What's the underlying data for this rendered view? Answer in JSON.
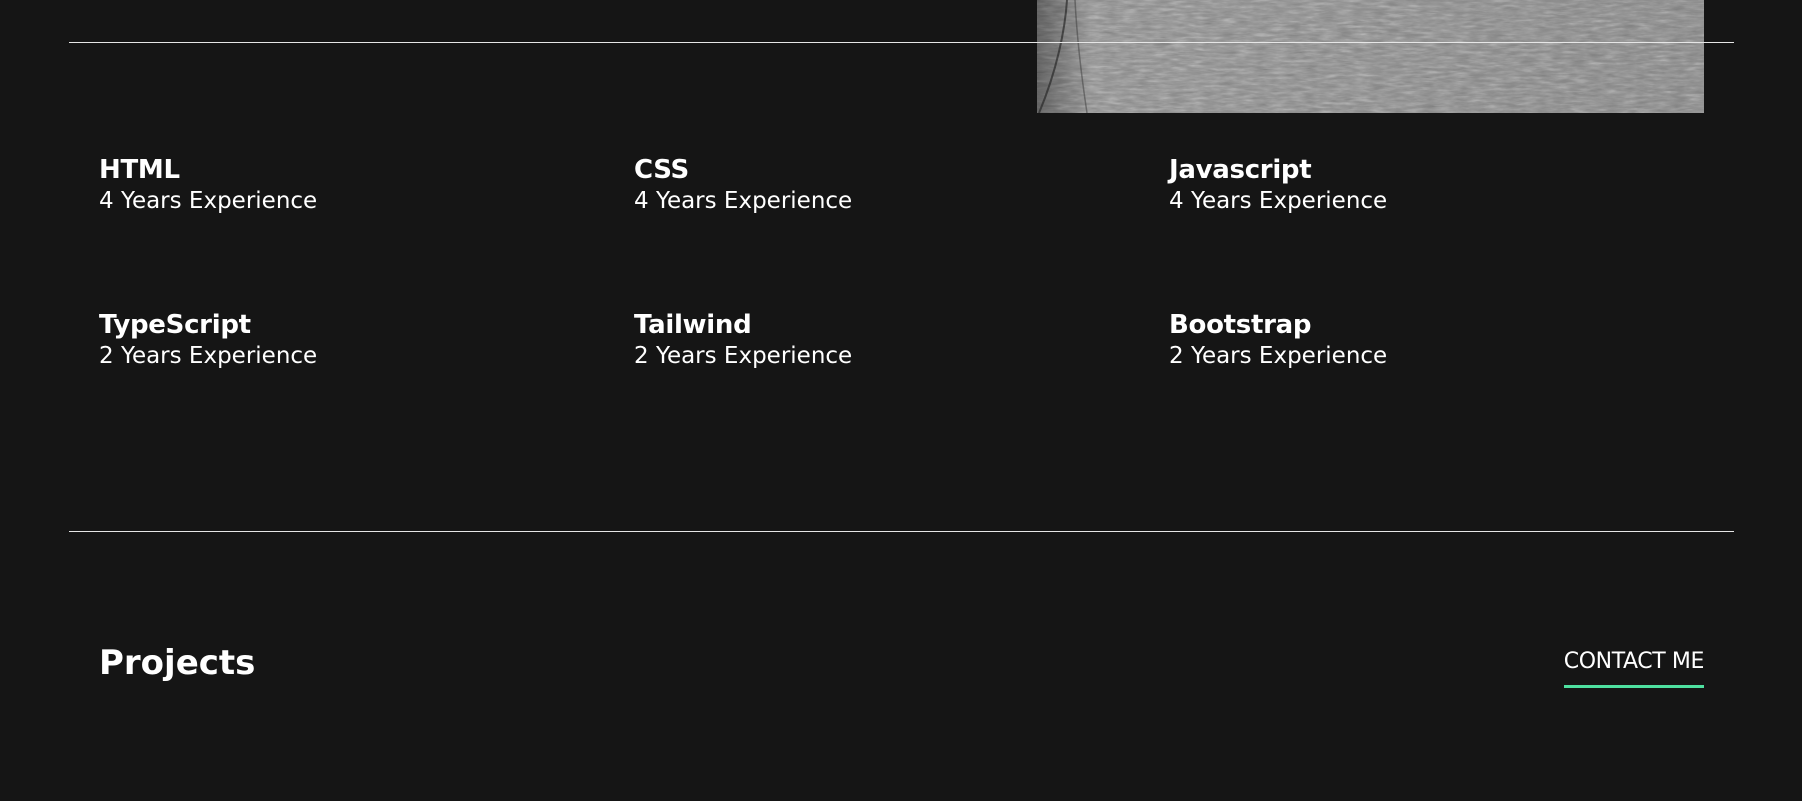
{
  "skills": [
    {
      "name": "HTML",
      "experience": "4 Years Experience"
    },
    {
      "name": "CSS",
      "experience": "4 Years Experience"
    },
    {
      "name": "Javascript",
      "experience": "4 Years Experience"
    },
    {
      "name": "TypeScript",
      "experience": "2 Years Experience"
    },
    {
      "name": "Tailwind",
      "experience": "2 Years Experience"
    },
    {
      "name": "Bootstrap",
      "experience": "2 Years Experience"
    }
  ],
  "projects": {
    "title": "Projects",
    "contact_label": "CONTACT ME"
  },
  "colors": {
    "background": "#151515",
    "text": "#ffffff",
    "accent": "#4ee1a0",
    "divider": "#e6e6e6"
  }
}
